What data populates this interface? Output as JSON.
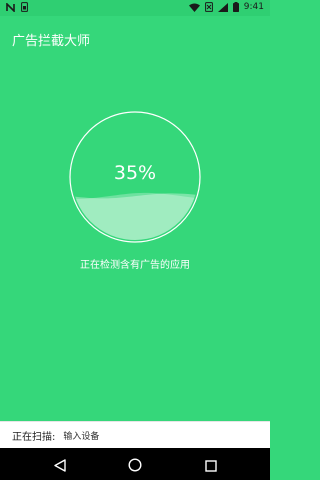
{
  "status_bar": {
    "time": "9:41",
    "left_icons": [
      "n-logo-icon",
      "sim-card-icon"
    ],
    "right_icons": [
      "wifi-icon",
      "no-sim-icon",
      "signal-icon",
      "battery-icon"
    ]
  },
  "app": {
    "title": "广告拦截大师"
  },
  "progress": {
    "percent_label": "35%",
    "percent_value": 35,
    "status": "正在检测含有广告的应用"
  },
  "scan": {
    "label": "正在扫描:",
    "current_item": "输入设备"
  },
  "nav": {
    "buttons": [
      "back-icon",
      "home-icon",
      "recents-icon"
    ]
  },
  "colors": {
    "primary": "#35d77a",
    "status_bar": "#2fcf72",
    "wave_fill": "#a6ecc1",
    "white": "#ffffff",
    "nav_bar": "#000000"
  }
}
